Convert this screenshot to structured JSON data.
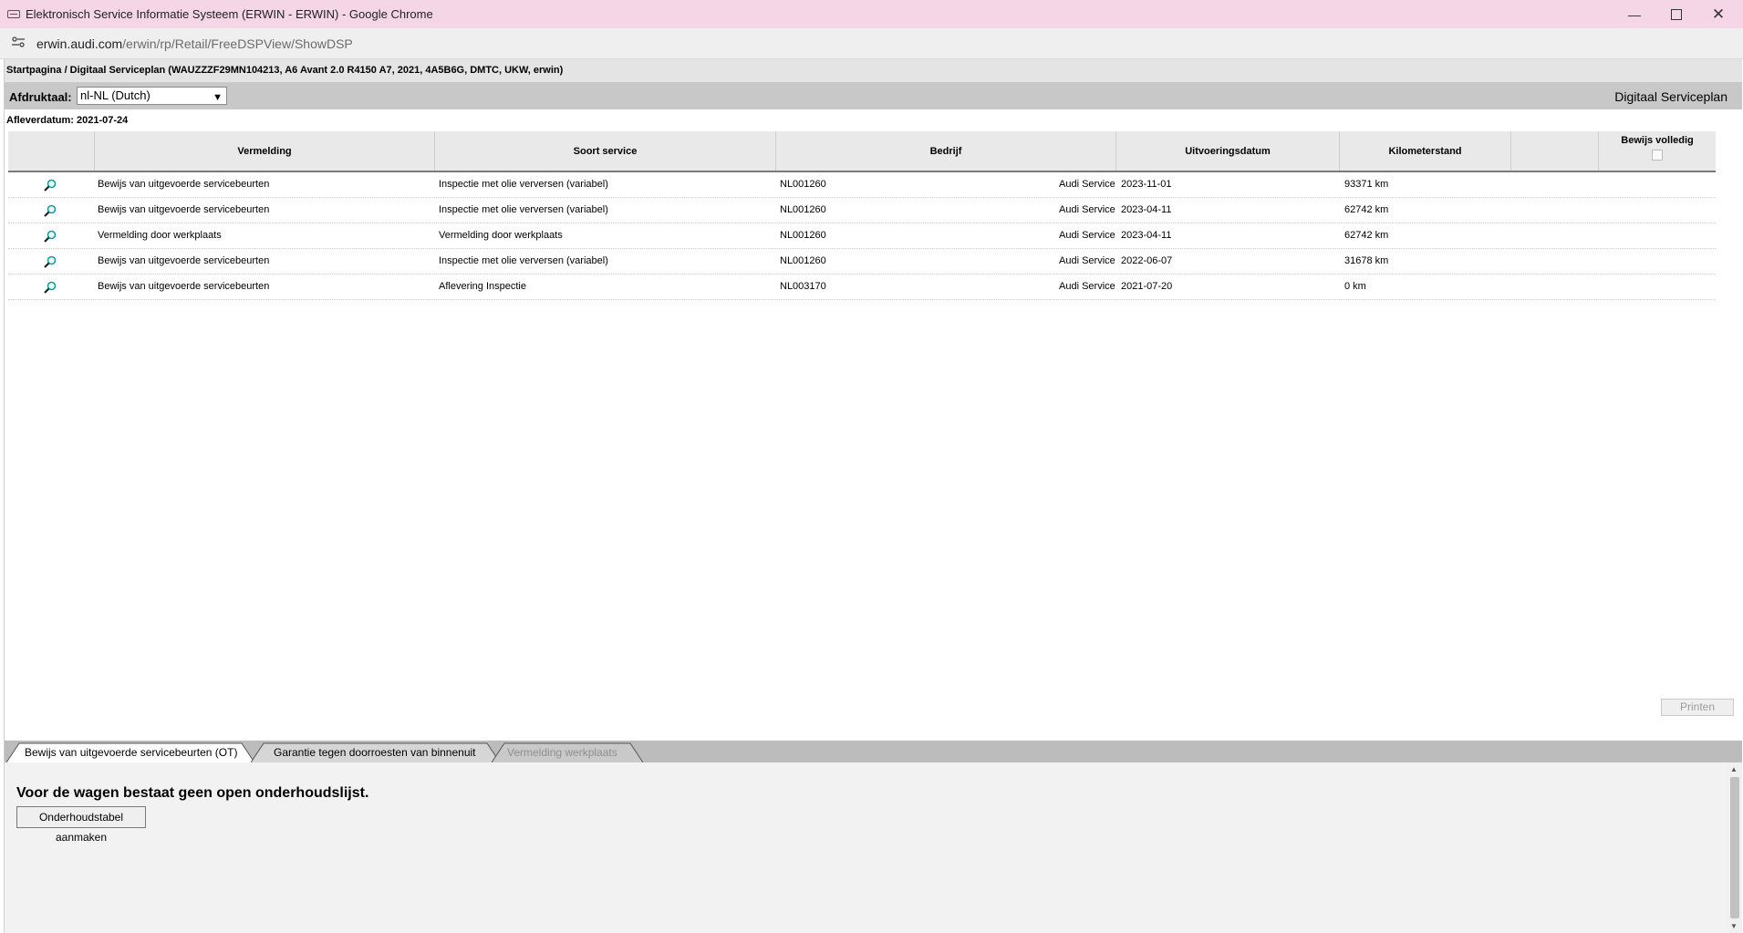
{
  "window": {
    "title": "Elektronisch Service Informatie Systeem (ERWIN - ERWIN) - Google Chrome",
    "url_host": "erwin.audi.com",
    "url_path": "/erwin/rp/Retail/FreeDSPView/ShowDSP"
  },
  "breadcrumb": "Startpagina / Digitaal Serviceplan (WAUZZZF29MN104213, A6 Avant 2.0 R4150 A7, 2021, 4A5B6G, DMTC, UKW, erwin)",
  "print_language": {
    "label": "Afdruktaal:",
    "selected": "nl-NL (Dutch)"
  },
  "page_heading": "Digitaal Serviceplan",
  "delivery_date": "Afleverdatum: 2021-07-24",
  "table": {
    "headers": {
      "vermelding": "Vermelding",
      "soort": "Soort service",
      "bedrijf": "Bedrijf",
      "datum": "Uitvoeringsdatum",
      "km": "Kilometerstand",
      "empty": "",
      "bewijs": "Bewijs volledig"
    },
    "rows": [
      {
        "vermelding": "Bewijs van uitgevoerde servicebeurten",
        "soort": "Inspectie met olie verversen (variabel)",
        "code": "NL001260",
        "bedrijf": "Audi Service",
        "datum": "2023-11-01",
        "km": "93371 km"
      },
      {
        "vermelding": "Bewijs van uitgevoerde servicebeurten",
        "soort": "Inspectie met olie verversen (variabel)",
        "code": "NL001260",
        "bedrijf": "Audi Service",
        "datum": "2023-04-11",
        "km": "62742 km"
      },
      {
        "vermelding": "Vermelding door werkplaats",
        "soort": "Vermelding door werkplaats",
        "code": "NL001260",
        "bedrijf": "Audi Service",
        "datum": "2023-04-11",
        "km": "62742 km"
      },
      {
        "vermelding": "Bewijs van uitgevoerde servicebeurten",
        "soort": "Inspectie met olie verversen (variabel)",
        "code": "NL001260",
        "bedrijf": "Audi Service",
        "datum": "2022-06-07",
        "km": "31678 km"
      },
      {
        "vermelding": "Bewijs van uitgevoerde servicebeurten",
        "soort": "Aflevering Inspectie",
        "code": "NL003170",
        "bedrijf": "Audi Service",
        "datum": "2021-07-20",
        "km": "0 km"
      }
    ]
  },
  "print_button": "Printen",
  "tabs": [
    {
      "label": "Bewijs van uitgevoerde servicebeurten (OT)",
      "state": "active"
    },
    {
      "label": "Garantie tegen doorroesten van binnenuit",
      "state": "normal"
    },
    {
      "label": "Vermelding werkplaats",
      "state": "disabled"
    }
  ],
  "panel": {
    "message": "Voor de wagen bestaat geen open onderhoudslijst.",
    "button": "Onderhoudstabel aanmaken"
  },
  "icons": {
    "row_action": "magnifier-icon",
    "site_info": "tune-icon"
  },
  "colors": {
    "titlebar": "#f4d6e7",
    "magnifier": "#1a9aa0"
  }
}
